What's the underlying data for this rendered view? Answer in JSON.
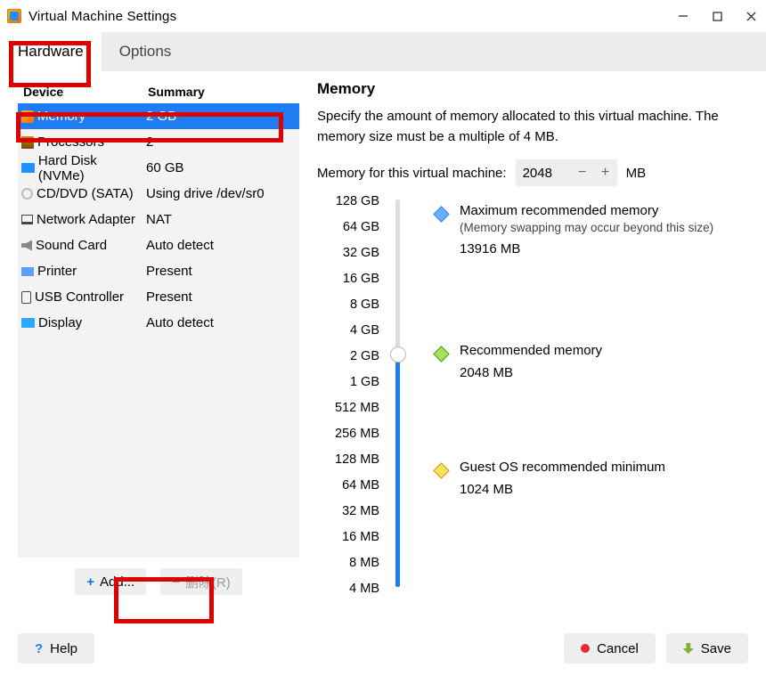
{
  "window": {
    "title": "Virtual Machine Settings"
  },
  "tabs": {
    "hardware": "Hardware",
    "options": "Options"
  },
  "device_header": {
    "col1": "Device",
    "col2": "Summary"
  },
  "devices": [
    {
      "icon": "ic-mem",
      "name": "Memory",
      "summary": "2 GB",
      "selected": true
    },
    {
      "icon": "ic-cpu",
      "name": "Processors",
      "summary": "2"
    },
    {
      "icon": "ic-hdd",
      "name": "Hard Disk (NVMe)",
      "summary": "60 GB"
    },
    {
      "icon": "ic-cd",
      "name": "CD/DVD (SATA)",
      "summary": "Using drive /dev/sr0"
    },
    {
      "icon": "ic-net",
      "name": "Network Adapter",
      "summary": "NAT"
    },
    {
      "icon": "ic-snd",
      "name": "Sound Card",
      "summary": "Auto detect"
    },
    {
      "icon": "ic-prn",
      "name": "Printer",
      "summary": "Present"
    },
    {
      "icon": "ic-usb",
      "name": "USB Controller",
      "summary": "Present"
    },
    {
      "icon": "ic-dsp",
      "name": "Display",
      "summary": "Auto detect"
    }
  ],
  "left_buttons": {
    "add": "Add...",
    "remove": "删除(R)"
  },
  "memory": {
    "title": "Memory",
    "desc": "Specify the amount of memory allocated to this virtual machine. The memory size must be a multiple of 4 MB.",
    "label": "Memory for this virtual machine:",
    "value": "2048",
    "unit": "MB",
    "ticks": [
      "128 GB",
      "64 GB",
      "32 GB",
      "16 GB",
      "8 GB",
      "4 GB",
      "2 GB",
      "1 GB",
      "512 MB",
      "256 MB",
      "128 MB",
      "64 MB",
      "32 MB",
      "16 MB",
      "8 MB",
      "4 MB"
    ],
    "markers": {
      "max": {
        "title": "Maximum recommended memory",
        "note": "(Memory swapping may occur beyond this size)",
        "value": "13916 MB",
        "color": "#2a84ff",
        "fill": "#6ab0ff",
        "pos": 0.04
      },
      "rec": {
        "title": "Recommended memory",
        "value": "2048 MB",
        "color": "#5a9e00",
        "fill": "#a5e060",
        "pos": 0.4
      },
      "guest": {
        "title": "Guest OS recommended minimum",
        "value": "1024 MB",
        "color": "#c9a200",
        "fill": "#ffe060",
        "pos": 0.7
      }
    },
    "thumb_pos": 0.4
  },
  "footer": {
    "help": "Help",
    "cancel": "Cancel",
    "save": "Save"
  }
}
